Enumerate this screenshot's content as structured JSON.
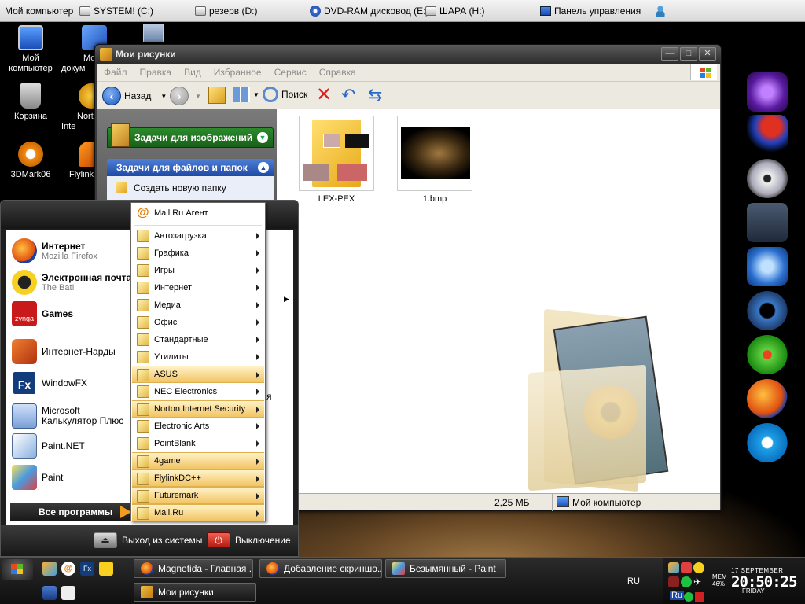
{
  "topbar": {
    "items": [
      {
        "label": "Мой компьютер"
      },
      {
        "label": "SYSTEM! (C:)"
      },
      {
        "label": "резерв (D:)"
      },
      {
        "label": "DVD-RAM дисковод (E:)"
      },
      {
        "label": "ШАРА (H:)"
      },
      {
        "label": "Панель управления"
      }
    ]
  },
  "desktop": {
    "icons": [
      {
        "label": "Мой компьютер"
      },
      {
        "label": "Мо докум"
      },
      {
        "label": "Корзина"
      },
      {
        "label": "Nort Inte"
      },
      {
        "label": "3DMark06"
      },
      {
        "label": "FlylinkI"
      }
    ]
  },
  "explorer": {
    "title": "Мои рисунки",
    "menu": [
      "Файл",
      "Правка",
      "Вид",
      "Избранное",
      "Сервис",
      "Справка"
    ],
    "toolbar": {
      "back": "Назад",
      "search": "Поиск"
    },
    "tasks": {
      "images_header": "Задачи для изображений",
      "files_header": "Задачи для файлов и папок",
      "create_folder": "Создать новую папку"
    },
    "files": [
      {
        "name": "LEX-PEX"
      },
      {
        "name": "1.bmp"
      }
    ],
    "status": {
      "size": "2,25 МБ",
      "location": "Мой компьютер"
    }
  },
  "start_menu": {
    "pinned": [
      {
        "title": "Интернет",
        "sub": "Mozilla Firefox"
      },
      {
        "title": "Электронная почта",
        "sub": "The Bat!"
      },
      {
        "title": "Games",
        "sub": ""
      }
    ],
    "recent": [
      {
        "title": "Интернет-Нарды"
      },
      {
        "title": "WindowFX"
      },
      {
        "title": "Microsoft Калькулятор Плюс"
      },
      {
        "title": "Paint.NET"
      },
      {
        "title": "Paint"
      }
    ],
    "all_programs": "Все программы",
    "logoff": "Выход из системы",
    "shutdown": "Выключение",
    "partial_right_text": "я"
  },
  "programs_menu": {
    "items": [
      {
        "label": "Mail.Ru Агент",
        "submenu": false,
        "highlight": false
      },
      {
        "label": "Автозагрузка",
        "submenu": true,
        "highlight": false
      },
      {
        "label": "Графика",
        "submenu": true,
        "highlight": false
      },
      {
        "label": "Игры",
        "submenu": true,
        "highlight": false
      },
      {
        "label": "Интернет",
        "submenu": true,
        "highlight": false
      },
      {
        "label": "Медиа",
        "submenu": true,
        "highlight": false
      },
      {
        "label": "Офис",
        "submenu": true,
        "highlight": false
      },
      {
        "label": "Стандартные",
        "submenu": true,
        "highlight": false
      },
      {
        "label": "Утилиты",
        "submenu": true,
        "highlight": false
      },
      {
        "label": "ASUS",
        "submenu": true,
        "highlight": true
      },
      {
        "label": "NEC Electronics",
        "submenu": true,
        "highlight": false
      },
      {
        "label": "Norton Internet Security",
        "submenu": true,
        "highlight": true
      },
      {
        "label": "Electronic Arts",
        "submenu": true,
        "highlight": false
      },
      {
        "label": "PointBlank",
        "submenu": true,
        "highlight": false
      },
      {
        "label": "4game",
        "submenu": true,
        "highlight": true
      },
      {
        "label": "FlylinkDC++",
        "submenu": true,
        "highlight": true
      },
      {
        "label": "Futuremark",
        "submenu": true,
        "highlight": true
      },
      {
        "label": "Mail.Ru",
        "submenu": true,
        "highlight": true
      }
    ]
  },
  "taskbar": {
    "tasks": [
      {
        "label": "Magnetida - Главная ..."
      },
      {
        "label": "Добавление скриншо..."
      },
      {
        "label": "Безымянный - Paint"
      },
      {
        "label": "Мои рисунки"
      }
    ],
    "lang": "RU",
    "tray_lang": "Ru",
    "mem_label": "MEM",
    "mem_value": "46%",
    "date": "17 SEPTEMBER",
    "time": "20:50:25",
    "day": "FRIDAY"
  },
  "colors": {
    "highlight": "#f2c464",
    "green_header": "#2c8a2c",
    "blue_header": "#1e4aa6"
  }
}
